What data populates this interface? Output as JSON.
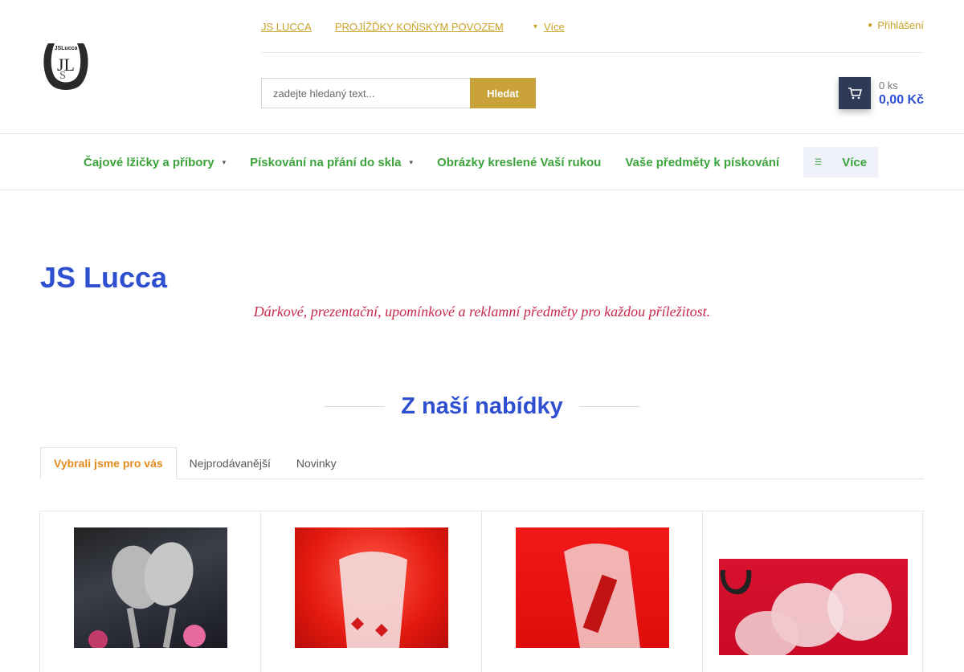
{
  "header": {
    "top_links": [
      "JS LUCCA",
      "PROJÍŽĎKY KOŇSKÝM POVOZEM"
    ],
    "more_label": "Více",
    "login_label": "Přihlášení",
    "logo_text": "JSLucca"
  },
  "search": {
    "placeholder": "zadejte hledaný text...",
    "button_label": "Hledat"
  },
  "cart": {
    "count": "0 ks",
    "total": "0,00 Kč"
  },
  "nav": {
    "items": [
      {
        "label": "Čajové lžičky a příbory",
        "has_submenu": true
      },
      {
        "label": "Pískování na přání do skla",
        "has_submenu": true
      },
      {
        "label": "Obrázky kreslené Vaší rukou",
        "has_submenu": false
      },
      {
        "label": "Vaše předměty k pískování",
        "has_submenu": false
      }
    ],
    "more_label": "Více"
  },
  "hero": {
    "title": "JS Lucca",
    "tagline": "Dárkové, prezentační, upomínkové a reklamní předměty pro každou příležitost."
  },
  "section": {
    "title": "Z naší nabídky",
    "tabs": [
      {
        "label": "Vybrali jsme pro vás",
        "active": true
      },
      {
        "label": "Nejprodávanější",
        "active": false
      },
      {
        "label": "Novinky",
        "active": false
      }
    ]
  },
  "colors": {
    "accent_gold": "#c9a23a",
    "nav_green": "#3aa43a",
    "title_blue": "#2f4fd1",
    "tagline_red": "#c8284a",
    "active_tab_orange": "#e28a1a",
    "cart_dark": "#2f3a56"
  },
  "icons": {
    "more": "chevron-down-icon",
    "login": "user-icon",
    "cart": "shopping-cart-icon",
    "nav_more": "menu-icon"
  }
}
